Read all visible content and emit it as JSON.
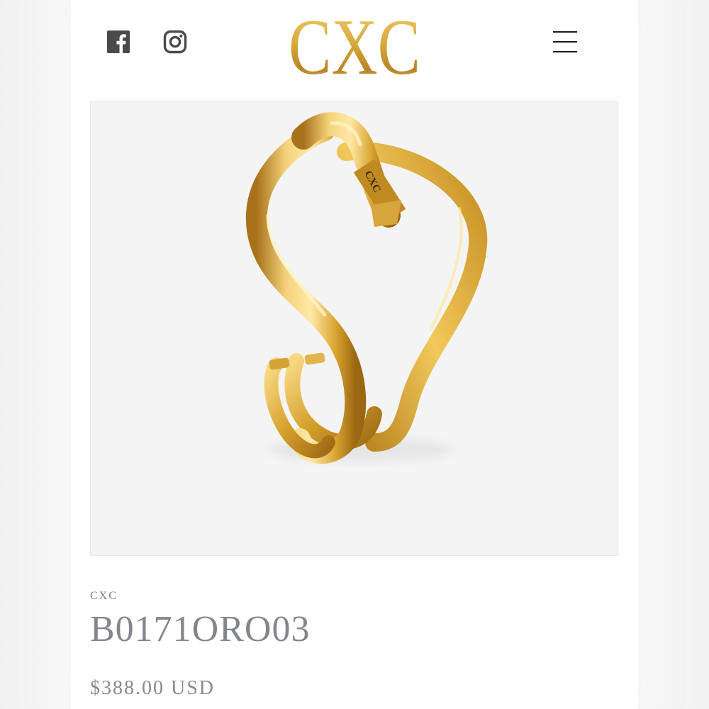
{
  "header": {
    "logo_text": "CXC",
    "social_icons": [
      "facebook-icon",
      "instagram-icon"
    ],
    "menu_icon": "hamburger-menu-icon"
  },
  "product": {
    "image_alt": "gold-knot-ring-image",
    "engraving": "CXC",
    "vendor": "CXC",
    "title": "B0171ORO03",
    "price": "$388.00 USD"
  },
  "colors": {
    "gold_light": "#f3d27a",
    "gold_mid": "#d9a730",
    "gold_dark": "#a9751a",
    "text_gray": "#84868d",
    "image_bg": "#f4f4f4"
  }
}
